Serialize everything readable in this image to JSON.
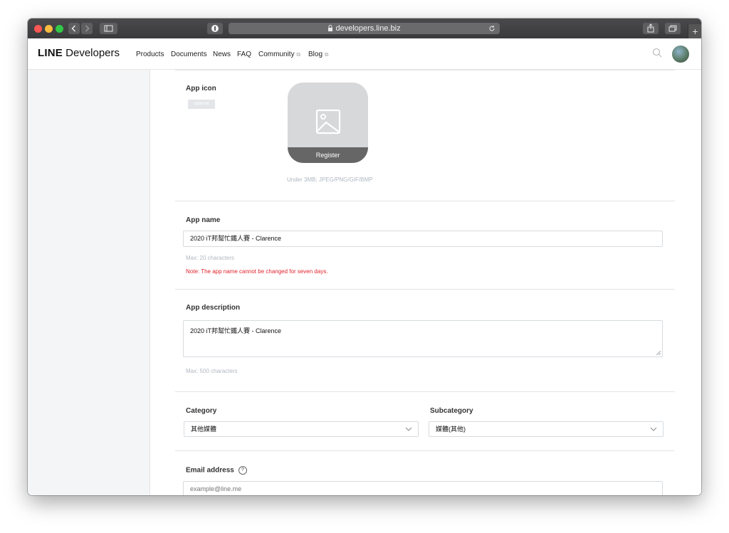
{
  "browser": {
    "url": "developers.line.biz",
    "colors": {
      "close": "#fc5753",
      "minimize": "#fdbc40",
      "zoom": "#33c748"
    }
  },
  "nav": {
    "logo_line": "LINE",
    "logo_developers": "Developers",
    "items": [
      "Products",
      "Documents",
      "News",
      "FAQ",
      "Community",
      "Blog"
    ]
  },
  "form": {
    "app_icon": {
      "label": "App icon",
      "badge": "optional",
      "register": "Register",
      "hint": "Under 3MB; JPEG/PNG/GIF/BMP"
    },
    "app_name": {
      "label": "App name",
      "value": "2020 iT邦幫忙鐵人賽 - Clarence",
      "hint": "Max: 20 characters",
      "note": "Note: The app name cannot be changed for seven days."
    },
    "app_description": {
      "label": "App description",
      "value": "2020 iT邦幫忙鐵人賽 - Clarence",
      "hint": "Max: 500 characters"
    },
    "category": {
      "label": "Category",
      "value": "其他媒體"
    },
    "subcategory": {
      "label": "Subcategory",
      "value": "媒體(其他)"
    },
    "email": {
      "label": "Email address",
      "help": "?",
      "placeholder": "example@line.me"
    }
  }
}
